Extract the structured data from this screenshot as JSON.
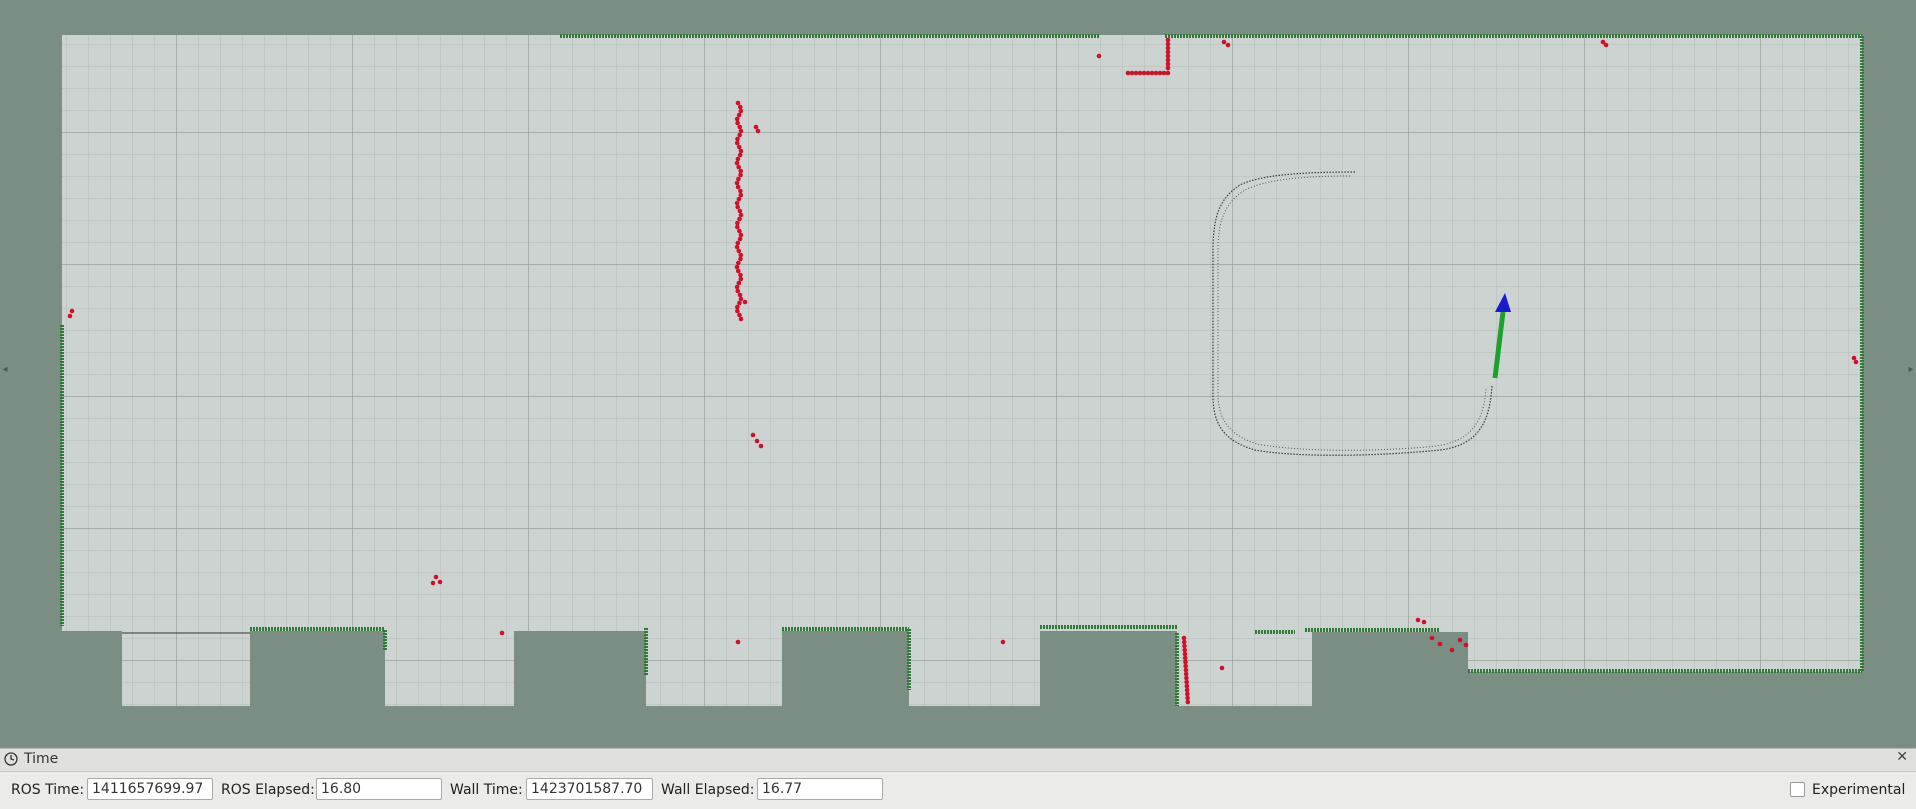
{
  "panel": {
    "title": "Time",
    "close_glyph": "✕",
    "icons": {
      "title": "clock-icon",
      "close": "close-icon"
    }
  },
  "time": {
    "ros_time_label": "ROS Time:",
    "ros_time_value": "1411657699.97",
    "ros_elapsed_label": "ROS Elapsed:",
    "ros_elapsed_value": "16.80",
    "wall_time_label": "Wall Time:",
    "wall_time_value": "1423701587.70",
    "wall_elapsed_label": "Wall Elapsed:",
    "wall_elapsed_value": "16.77",
    "experimental_label": "Experimental",
    "experimental_checked": false
  },
  "viewport": {
    "colors": {
      "background": "#7b8e84",
      "free_space": "#cdd3d0",
      "grid": "#9aa39e",
      "wall": "#2f7a34",
      "laser": "#d01028",
      "path": "#3a3a3a",
      "pose_arrow": "#1ea12c",
      "pose_arrow_head": "#1a1ad0"
    },
    "left_handle_glyph": "◂",
    "right_handle_glyph": "▸"
  }
}
